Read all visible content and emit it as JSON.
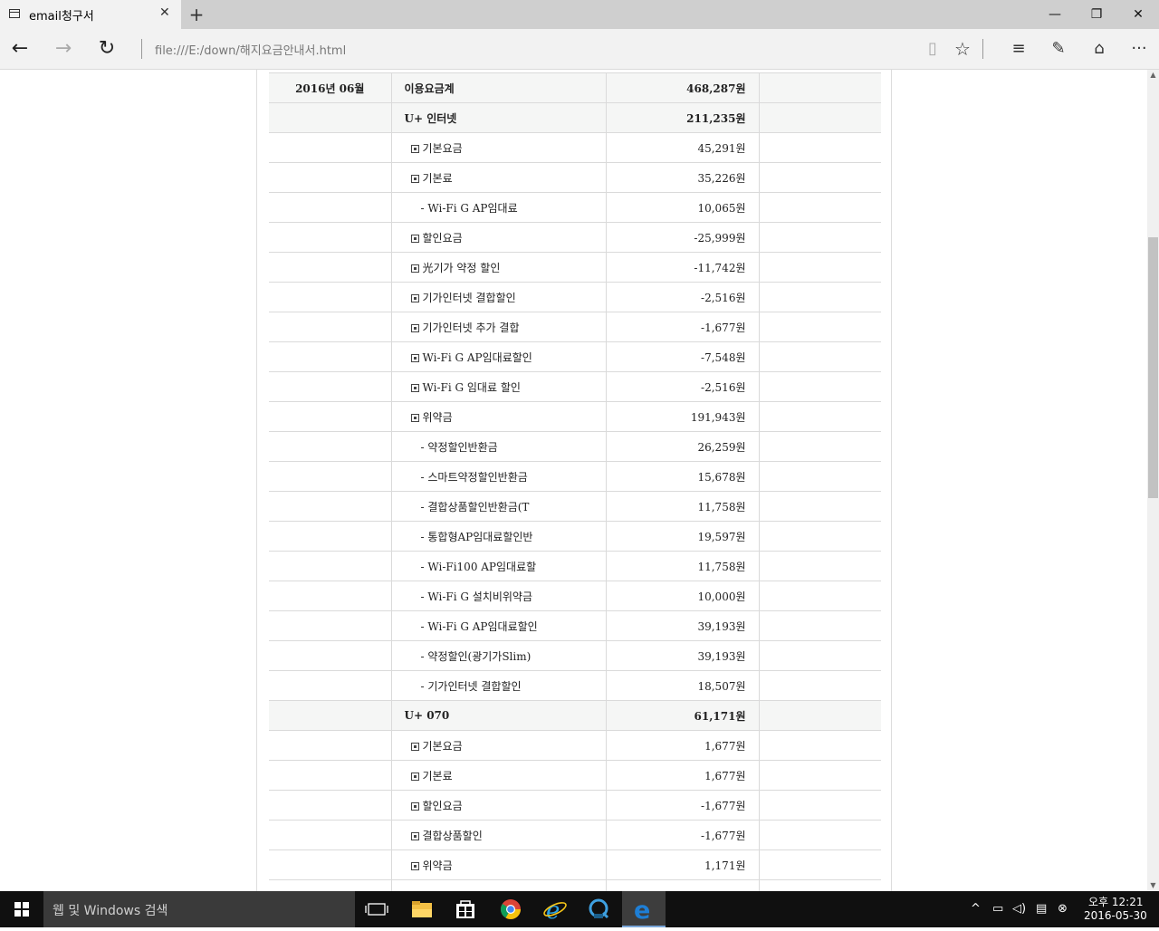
{
  "browser": {
    "tab_title": "email청구서",
    "tab_close": "✕",
    "new_tab": "+",
    "address": "file:///E:/down/해지요금안내서.html",
    "window_controls": {
      "minimize": "—",
      "restore": "❐",
      "close": "✕"
    },
    "nav": {
      "back": "←",
      "forward": "→",
      "refresh": "↻"
    },
    "tools": {
      "reading_view": "▯",
      "favorite": "☆",
      "hub": "≡",
      "note": "✎",
      "share": "⌂",
      "more": "···"
    }
  },
  "bill": {
    "rows": [
      {
        "period": "2016년 06월",
        "name": "이용요금계",
        "amount": "468,287원",
        "kind": "total"
      },
      {
        "period": "",
        "name": "U+ 인터넷",
        "amount": "211,235원",
        "kind": "group"
      },
      {
        "period": "",
        "name": "기본요금",
        "amount": "45,291원",
        "kind": "item"
      },
      {
        "period": "",
        "name": "기본료",
        "amount": "35,226원",
        "kind": "item"
      },
      {
        "period": "",
        "name": "- Wi-Fi G AP임대료",
        "amount": "10,065원",
        "kind": "sub"
      },
      {
        "period": "",
        "name": "할인요금",
        "amount": "-25,999원",
        "kind": "item"
      },
      {
        "period": "",
        "name": "光기가 약정 할인",
        "amount": "-11,742원",
        "kind": "item"
      },
      {
        "period": "",
        "name": "기가인터넷 결합할인",
        "amount": "-2,516원",
        "kind": "item"
      },
      {
        "period": "",
        "name": "기가인터넷 추가 결합",
        "amount": "-1,677원",
        "kind": "item"
      },
      {
        "period": "",
        "name": "Wi-Fi G AP임대료할인",
        "amount": "-7,548원",
        "kind": "item"
      },
      {
        "period": "",
        "name": "Wi-Fi G 임대료 할인",
        "amount": "-2,516원",
        "kind": "item"
      },
      {
        "period": "",
        "name": "위약금",
        "amount": "191,943원",
        "kind": "item"
      },
      {
        "period": "",
        "name": "- 약정할인반환금",
        "amount": "26,259원",
        "kind": "sub"
      },
      {
        "period": "",
        "name": "- 스마트약정할인반환금",
        "amount": "15,678원",
        "kind": "sub"
      },
      {
        "period": "",
        "name": "- 결합상품할인반환금(T",
        "amount": "11,758원",
        "kind": "sub"
      },
      {
        "period": "",
        "name": "- 통합형AP임대료할인반",
        "amount": "19,597원",
        "kind": "sub"
      },
      {
        "period": "",
        "name": "- Wi-Fi100 AP임대료할",
        "amount": "11,758원",
        "kind": "sub"
      },
      {
        "period": "",
        "name": "- Wi-Fi G 설치비위약금",
        "amount": "10,000원",
        "kind": "sub"
      },
      {
        "period": "",
        "name": "- Wi-Fi G AP임대료할인",
        "amount": "39,193원",
        "kind": "sub"
      },
      {
        "period": "",
        "name": "- 약정할인(광기가Slim)",
        "amount": "39,193원",
        "kind": "sub"
      },
      {
        "period": "",
        "name": "- 기가인터넷 결합할인",
        "amount": "18,507원",
        "kind": "sub"
      },
      {
        "period": "",
        "name": "U+ 070",
        "amount": "61,171원",
        "kind": "group"
      },
      {
        "period": "",
        "name": "기본요금",
        "amount": "1,677원",
        "kind": "item"
      },
      {
        "period": "",
        "name": "기본료",
        "amount": "1,677원",
        "kind": "item"
      },
      {
        "period": "",
        "name": "할인요금",
        "amount": "-1,677원",
        "kind": "item"
      },
      {
        "period": "",
        "name": "결합상품할인",
        "amount": "-1,677원",
        "kind": "item"
      },
      {
        "period": "",
        "name": "위약금",
        "amount": "1,171원",
        "kind": "item"
      },
      {
        "period": "",
        "name": "",
        "amount": "",
        "kind": "item-empty"
      }
    ]
  },
  "taskbar": {
    "search_placeholder": "웹 및 Windows 검색",
    "time": "오후 12:21",
    "date": "2016-05-30"
  },
  "colors": {
    "highlight_row": "#f5f6f5",
    "grid_line": "#dadada",
    "edge_blue": "#1e7fd6",
    "taskbar": "#101010"
  }
}
